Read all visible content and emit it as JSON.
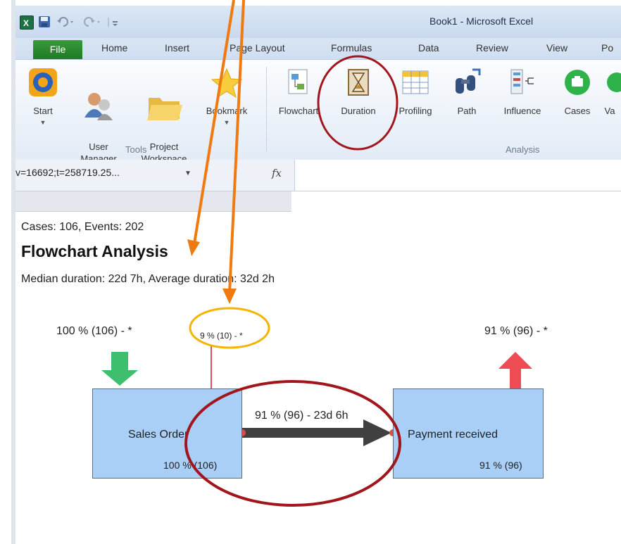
{
  "window": {
    "title": "Book1  -  Microsoft Excel",
    "quick_access": [
      "excel-app-icon",
      "save-icon",
      "undo-icon",
      "redo-icon",
      "customize-icon"
    ]
  },
  "tabs": [
    "File",
    "Home",
    "Insert",
    "Page Layout",
    "Formulas",
    "Data",
    "Review",
    "View",
    "Po"
  ],
  "ribbon": {
    "tools_group_label": "Tools",
    "analysis_group_label": "Analysis",
    "tools": [
      {
        "label": "Start",
        "icon": "start-icon"
      },
      {
        "label": "User\nManager",
        "icon": "user-manager-icon"
      },
      {
        "label": "Project\nWorkspace",
        "icon": "folder-icon"
      },
      {
        "label": "Bookmark",
        "icon": "star-icon"
      }
    ],
    "analysis": [
      {
        "label": "Flowchart",
        "icon": "flowchart-icon"
      },
      {
        "label": "Duration",
        "icon": "hourglass-icon"
      },
      {
        "label": "Profiling",
        "icon": "table-icon"
      },
      {
        "label": "Path",
        "icon": "binoculars-icon"
      },
      {
        "label": "Influence",
        "icon": "influence-icon"
      },
      {
        "label": "Cases",
        "icon": "cases-icon"
      },
      {
        "label": "Va",
        "icon": "variants-icon"
      }
    ]
  },
  "formula_bar": {
    "name_box": "v=16692;t=258719.25...",
    "fx": "fx",
    "formula": ""
  },
  "sheet": {
    "summary": "Cases: 106, Events: 202",
    "heading": "Flowchart Analysis",
    "durations": "Median duration: 22d 7h, Average duration: 32d 2h"
  },
  "flowchart": {
    "start_label": "100 % (106) - *",
    "exit_label_small": "9 % (10) - *",
    "end_label": "91 % (96) - *",
    "edge_label": "91 % (96) - 23d 6h",
    "nodes": [
      {
        "name": "Sales Order",
        "stat": "100 % (106)"
      },
      {
        "name": "Payment received",
        "stat": "91 % (96)"
      }
    ],
    "colors": {
      "node_fill": "#a9cff7",
      "start_arrow": "#3dbf6e",
      "end_arrow": "#ef4b55",
      "edge": "#404040",
      "annotation_ellipse": "#a0161c",
      "annotation_highlight": "#f4b400",
      "annotation_arrows": "#ef7a10"
    }
  }
}
